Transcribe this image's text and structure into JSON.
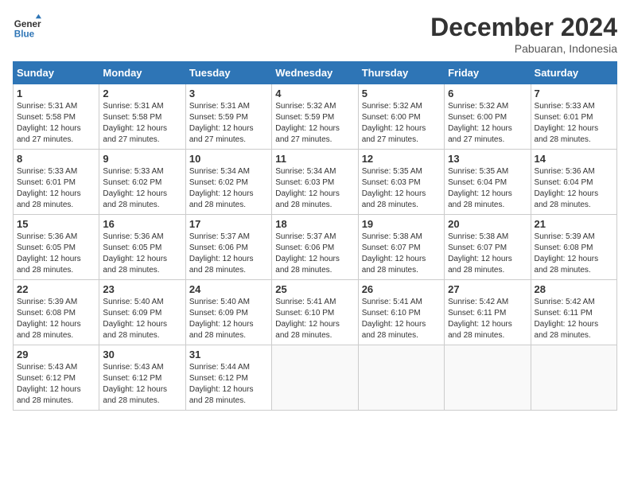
{
  "logo": {
    "line1": "General",
    "line2": "Blue"
  },
  "title": "December 2024",
  "location": "Pabuaran, Indonesia",
  "days_of_week": [
    "Sunday",
    "Monday",
    "Tuesday",
    "Wednesday",
    "Thursday",
    "Friday",
    "Saturday"
  ],
  "weeks": [
    [
      {
        "day": 1,
        "sunrise": "5:31 AM",
        "sunset": "5:58 PM",
        "daylight": "12 hours and 27 minutes."
      },
      {
        "day": 2,
        "sunrise": "5:31 AM",
        "sunset": "5:58 PM",
        "daylight": "12 hours and 27 minutes."
      },
      {
        "day": 3,
        "sunrise": "5:31 AM",
        "sunset": "5:59 PM",
        "daylight": "12 hours and 27 minutes."
      },
      {
        "day": 4,
        "sunrise": "5:32 AM",
        "sunset": "5:59 PM",
        "daylight": "12 hours and 27 minutes."
      },
      {
        "day": 5,
        "sunrise": "5:32 AM",
        "sunset": "6:00 PM",
        "daylight": "12 hours and 27 minutes."
      },
      {
        "day": 6,
        "sunrise": "5:32 AM",
        "sunset": "6:00 PM",
        "daylight": "12 hours and 27 minutes."
      },
      {
        "day": 7,
        "sunrise": "5:33 AM",
        "sunset": "6:01 PM",
        "daylight": "12 hours and 28 minutes."
      }
    ],
    [
      {
        "day": 8,
        "sunrise": "5:33 AM",
        "sunset": "6:01 PM",
        "daylight": "12 hours and 28 minutes."
      },
      {
        "day": 9,
        "sunrise": "5:33 AM",
        "sunset": "6:02 PM",
        "daylight": "12 hours and 28 minutes."
      },
      {
        "day": 10,
        "sunrise": "5:34 AM",
        "sunset": "6:02 PM",
        "daylight": "12 hours and 28 minutes."
      },
      {
        "day": 11,
        "sunrise": "5:34 AM",
        "sunset": "6:03 PM",
        "daylight": "12 hours and 28 minutes."
      },
      {
        "day": 12,
        "sunrise": "5:35 AM",
        "sunset": "6:03 PM",
        "daylight": "12 hours and 28 minutes."
      },
      {
        "day": 13,
        "sunrise": "5:35 AM",
        "sunset": "6:04 PM",
        "daylight": "12 hours and 28 minutes."
      },
      {
        "day": 14,
        "sunrise": "5:36 AM",
        "sunset": "6:04 PM",
        "daylight": "12 hours and 28 minutes."
      }
    ],
    [
      {
        "day": 15,
        "sunrise": "5:36 AM",
        "sunset": "6:05 PM",
        "daylight": "12 hours and 28 minutes."
      },
      {
        "day": 16,
        "sunrise": "5:36 AM",
        "sunset": "6:05 PM",
        "daylight": "12 hours and 28 minutes."
      },
      {
        "day": 17,
        "sunrise": "5:37 AM",
        "sunset": "6:06 PM",
        "daylight": "12 hours and 28 minutes."
      },
      {
        "day": 18,
        "sunrise": "5:37 AM",
        "sunset": "6:06 PM",
        "daylight": "12 hours and 28 minutes."
      },
      {
        "day": 19,
        "sunrise": "5:38 AM",
        "sunset": "6:07 PM",
        "daylight": "12 hours and 28 minutes."
      },
      {
        "day": 20,
        "sunrise": "5:38 AM",
        "sunset": "6:07 PM",
        "daylight": "12 hours and 28 minutes."
      },
      {
        "day": 21,
        "sunrise": "5:39 AM",
        "sunset": "6:08 PM",
        "daylight": "12 hours and 28 minutes."
      }
    ],
    [
      {
        "day": 22,
        "sunrise": "5:39 AM",
        "sunset": "6:08 PM",
        "daylight": "12 hours and 28 minutes."
      },
      {
        "day": 23,
        "sunrise": "5:40 AM",
        "sunset": "6:09 PM",
        "daylight": "12 hours and 28 minutes."
      },
      {
        "day": 24,
        "sunrise": "5:40 AM",
        "sunset": "6:09 PM",
        "daylight": "12 hours and 28 minutes."
      },
      {
        "day": 25,
        "sunrise": "5:41 AM",
        "sunset": "6:10 PM",
        "daylight": "12 hours and 28 minutes."
      },
      {
        "day": 26,
        "sunrise": "5:41 AM",
        "sunset": "6:10 PM",
        "daylight": "12 hours and 28 minutes."
      },
      {
        "day": 27,
        "sunrise": "5:42 AM",
        "sunset": "6:11 PM",
        "daylight": "12 hours and 28 minutes."
      },
      {
        "day": 28,
        "sunrise": "5:42 AM",
        "sunset": "6:11 PM",
        "daylight": "12 hours and 28 minutes."
      }
    ],
    [
      {
        "day": 29,
        "sunrise": "5:43 AM",
        "sunset": "6:12 PM",
        "daylight": "12 hours and 28 minutes."
      },
      {
        "day": 30,
        "sunrise": "5:43 AM",
        "sunset": "6:12 PM",
        "daylight": "12 hours and 28 minutes."
      },
      {
        "day": 31,
        "sunrise": "5:44 AM",
        "sunset": "6:12 PM",
        "daylight": "12 hours and 28 minutes."
      },
      null,
      null,
      null,
      null
    ]
  ]
}
